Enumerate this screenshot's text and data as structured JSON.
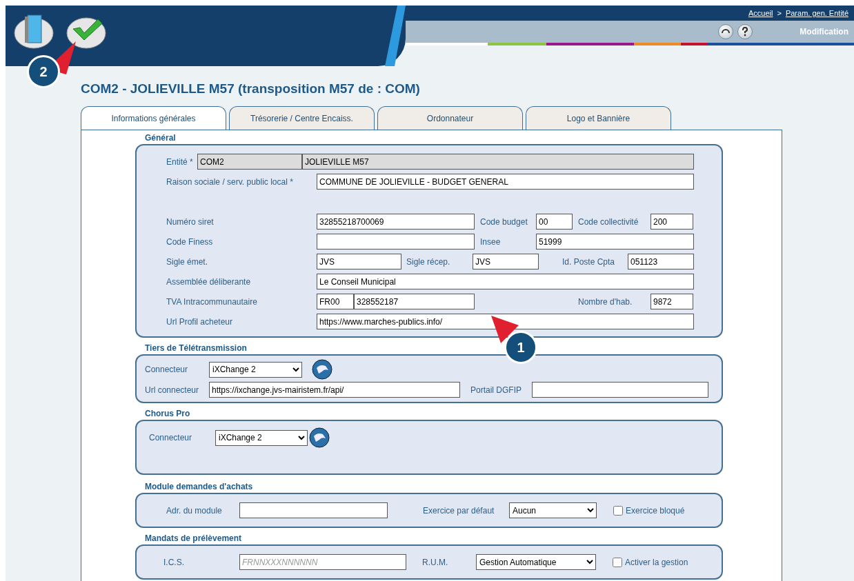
{
  "header": {
    "breadcrumb": [
      {
        "label": "Accueil"
      },
      {
        "label": "Param. gen. Entité"
      }
    ],
    "separator": ">",
    "mode": "Modification"
  },
  "callouts": [
    {
      "label": "2"
    },
    {
      "label": "1"
    }
  ],
  "title": "COM2 - JOLIEVILLE M57 (transposition M57 de : COM)",
  "tabs": [
    {
      "label": "Informations générales",
      "selected": true
    },
    {
      "label": "Trésorerie / Centre Encaiss.",
      "selected": false
    },
    {
      "label": "Ordonnateur",
      "selected": false
    },
    {
      "label": "Logo et Bannière",
      "selected": false
    }
  ],
  "general": {
    "title": "Général",
    "entite": {
      "label": "Entité *",
      "code": "COM2",
      "name": "JOLIEVILLE M57"
    },
    "raison_sociale": {
      "label": "Raison sociale / serv. public local *",
      "value": "COMMUNE DE JOLIEVILLE - BUDGET GENERAL"
    },
    "numero_siret": {
      "label": "Numéro siret",
      "value": "32855218700069"
    },
    "code_budget": {
      "label": "Code budget",
      "value": "00"
    },
    "code_collectivite": {
      "label": "Code collectivité",
      "value": "200"
    },
    "code_finess": {
      "label": "Code Finess"
    },
    "insee": {
      "label": "Insee",
      "value": "51999"
    },
    "sigle_emet": {
      "label": "Sigle émet.",
      "value": "JVS"
    },
    "sigle_recep": {
      "label": "Sigle récep.",
      "value": "JVS"
    },
    "id_poste_cpta": {
      "label": "Id. Poste Cpta",
      "value": "051123"
    },
    "assemblee": {
      "label": "Assemblée déliberante",
      "value": "Le Conseil Municipal"
    },
    "tva": {
      "label": "TVA Intracommunautaire",
      "prefix": "FR00",
      "value": "328552187"
    },
    "nombre_hab": {
      "label": "Nombre d'hab.",
      "value": "9872"
    },
    "url_profil": {
      "label": "Url Profil acheteur",
      "value": "https://www.marches-publics.info/"
    }
  },
  "teletransmission": {
    "title": "Tiers de Télétransmission",
    "connecteur": {
      "label": "Connecteur",
      "value": "iXChange 2"
    },
    "url_connecteur": {
      "label": "Url connecteur",
      "value": "https://ixchange.jvs-mairistem.fr/api/"
    },
    "portail_dgfip": {
      "label": "Portail DGFIP"
    }
  },
  "chorus": {
    "title": "Chorus Pro",
    "connecteur": {
      "label": "Connecteur",
      "value": "iXChange 2"
    }
  },
  "module_achats": {
    "title": "Module demandes d'achats",
    "adresse": {
      "label": "Adr. du module"
    },
    "exercice": {
      "label": "Exercice par défaut",
      "value": "Aucun"
    },
    "bloque": {
      "label": "Exercice bloqué",
      "checked": false
    }
  },
  "mandats": {
    "title": "Mandats de prélèvement",
    "ics": {
      "label": "I.C.S.",
      "placeholder": "FRNNXXXNNNNNN"
    },
    "rum": {
      "label": "R.U.M.",
      "value": "Gestion Automatique"
    },
    "activer": {
      "label": "Activer la gestion",
      "checked": false
    }
  }
}
